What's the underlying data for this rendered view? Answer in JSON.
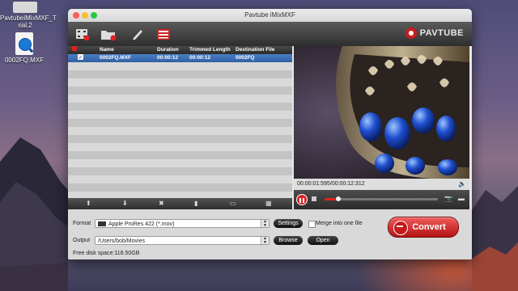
{
  "desktop": {
    "items": [
      {
        "label": "PavtubeiMixMXF_T\nrial.2"
      },
      {
        "label": "0002FQ.MXF"
      }
    ]
  },
  "window": {
    "title": "Pavtube iMixMXF",
    "brand": "PAVTUBE"
  },
  "toolbar": {
    "buttons": [
      "add-video-icon",
      "add-folder-icon",
      "edit-icon",
      "merge-list-icon"
    ]
  },
  "file_list": {
    "columns": [
      "Name",
      "Duration",
      "Trimmed Length",
      "Destination File"
    ],
    "rows": [
      {
        "name": "0002FQ.MXF",
        "duration": "00:00:12",
        "trimmed": "00:00:12",
        "destination": "0002FQ",
        "checked": true
      }
    ]
  },
  "preview": {
    "time": "00:00:01:595/00:00:12:312",
    "progress_fraction": 0.12
  },
  "settings": {
    "format_label": "Format",
    "format_value": "Apple ProRes 422 (*.mov)",
    "settings_button": "Settings",
    "merge_label": "Merge into one file",
    "output_label": "Output",
    "output_value": "/Users/bob/Movies",
    "browse_button": "Browse",
    "open_button": "Open",
    "free_disk": "Free disk space:118.50GB",
    "convert_button": "Convert"
  },
  "colors": {
    "accent_red": "#d22222",
    "selection_blue": "#2f5fa2"
  }
}
